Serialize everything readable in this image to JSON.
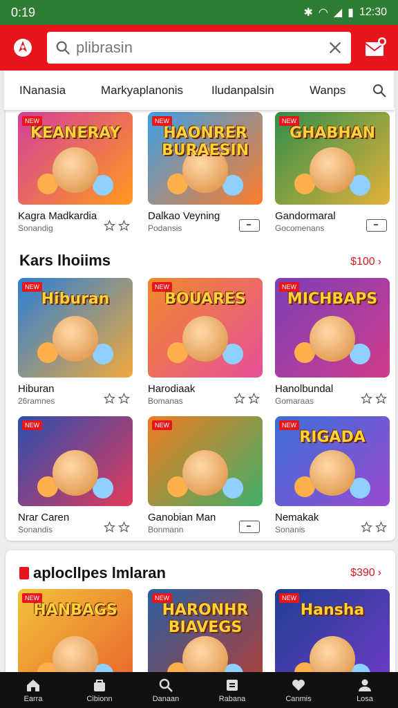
{
  "status_bar": {
    "time": "0:19",
    "clock": "12:30",
    "icons": [
      "nfc-icon",
      "wifi-icon",
      "signal-icon",
      "battery-icon"
    ]
  },
  "search": {
    "placeholder": "plibrasin"
  },
  "tabs": [
    {
      "label": "INanasia"
    },
    {
      "label": "Markyaplanonis"
    },
    {
      "label": "Iludanpalsin"
    },
    {
      "label": "Wanps"
    }
  ],
  "section1": {
    "rows": [
      [
        {
          "name": "Kagra Madkardia",
          "sub": "Sonandig",
          "meta": "stars",
          "art": "KEANERAY",
          "bg": [
            "#d43f9a",
            "#ff9a1f"
          ]
        },
        {
          "name": "Dalkao Veyning",
          "sub": "Podansis",
          "meta": "controller",
          "art": "HAONRER BURAESIN",
          "bg": [
            "#3aa0e8",
            "#ff7d2a"
          ]
        },
        {
          "name": "Gandormaral",
          "sub": "Gocomenans",
          "meta": "controller",
          "art": "GHABHAN",
          "bg": [
            "#2f8f4a",
            "#e2b23a"
          ]
        }
      ]
    ],
    "title": "Kars lhoiims",
    "more": "$100",
    "rows2": [
      [
        {
          "name": "Hiburan",
          "sub": "26ramnes",
          "meta": "stars",
          "art": "Hiburan",
          "bg": [
            "#2a7fd6",
            "#f2a93a"
          ]
        },
        {
          "name": "Harodiaak",
          "sub": "Bomanas",
          "meta": "stars",
          "art": "BOUARES",
          "bg": [
            "#f08a2a",
            "#e84f9a"
          ]
        },
        {
          "name": "Hanolbundal",
          "sub": "Gomaraas",
          "meta": "stars",
          "art": "MICHBAPS",
          "bg": [
            "#7b3fb8",
            "#d23c8a"
          ]
        }
      ],
      [
        {
          "name": "Nrar Caren",
          "sub": "Sonandis",
          "meta": "stars",
          "art": "",
          "bg": [
            "#2a4fb0",
            "#e23a5a"
          ]
        },
        {
          "name": "Ganobian Man",
          "sub": "Bonmann",
          "meta": "controller",
          "art": "",
          "bg": [
            "#f07a1f",
            "#3fb06a"
          ]
        },
        {
          "name": "Nemakak",
          "sub": "Sonanis",
          "meta": "stars",
          "art": "RIGADA",
          "bg": [
            "#3a6fd8",
            "#9a4ad0"
          ]
        }
      ]
    ]
  },
  "section2": {
    "title": "aplocllpes lmlaran",
    "more": "$390",
    "tiles": [
      {
        "art": "HANBAGS",
        "bg": [
          "#f2c23a",
          "#e85a2a"
        ]
      },
      {
        "art": "HARONHR BIAVEGS",
        "bg": [
          "#2a5fa0",
          "#c23a2a"
        ]
      },
      {
        "art": "Hansha",
        "bg": [
          "#1f3f90",
          "#7a3ad0"
        ]
      }
    ]
  },
  "bottom_nav": [
    {
      "label": "Earra",
      "icon": "home-icon"
    },
    {
      "label": "Cibionn",
      "icon": "bag-icon"
    },
    {
      "label": "Danaan",
      "icon": "search-icon"
    },
    {
      "label": "Rabana",
      "icon": "library-icon"
    },
    {
      "label": "Canmis",
      "icon": "heart-icon"
    },
    {
      "label": "Losa",
      "icon": "profile-icon"
    }
  ],
  "colors": {
    "accent": "#e8151c",
    "status": "#2e7d32",
    "nav": "#111111",
    "more": "#d61b1b"
  }
}
